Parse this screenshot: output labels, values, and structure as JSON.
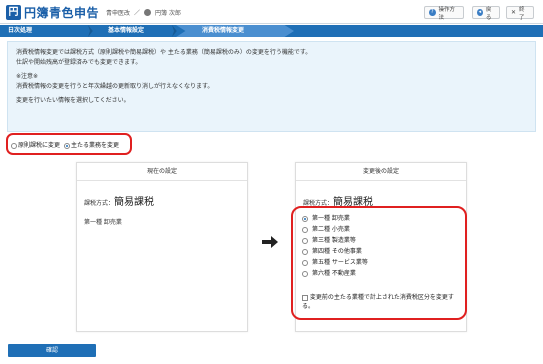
{
  "app": {
    "logo_glyph": "円",
    "title": "円簿青色申告"
  },
  "user": {
    "office": "青申医改",
    "separator": "／",
    "name": "円簿 次郎"
  },
  "header_buttons": [
    {
      "label": "操作方法",
      "icon": "help-icon"
    },
    {
      "label": "戻る",
      "icon": "back-icon"
    },
    {
      "label": "終了",
      "icon": "close-icon"
    }
  ],
  "breadcrumb": {
    "items": [
      "日次処理",
      "基本情報設定",
      "消費税情報変更"
    ]
  },
  "info": {
    "line1": "消費税情報変更では課税方式（原則課税や簡易課税）や 主たる業務（簡易課税のみ）の変更を行う機能です。",
    "line2": "仕訳や開始残高が登録済みでも変更できます。",
    "note_title": "※注意※",
    "note_body": "消費税情報の変更を行うと年次繰越の更新取り消しが行えなくなります。",
    "instruction": "変更を行いたい情報を選択してください。"
  },
  "mode_options": [
    {
      "label": "原則課税に変更",
      "selected": false
    },
    {
      "label": "主たる業務を変更",
      "selected": true
    }
  ],
  "current": {
    "title": "現在の設定",
    "tax_label": "課税方式：",
    "tax_value": "簡易課税",
    "business": "第一種 卸売業"
  },
  "after": {
    "title": "変更後の設定",
    "tax_label": "課税方式：",
    "tax_value": "簡易課税",
    "options": [
      {
        "label": "第一種 卸売業",
        "selected": true
      },
      {
        "label": "第二種 小売業",
        "selected": false
      },
      {
        "label": "第三種 製造業等",
        "selected": false
      },
      {
        "label": "第四種 その他事業",
        "selected": false
      },
      {
        "label": "第五種 サービス業等",
        "selected": false
      },
      {
        "label": "第六種 不動産業",
        "selected": false
      }
    ],
    "checkbox_label": "変更前の主たる業種で計上された消費税区分を変更する。"
  },
  "confirm_label": "確認",
  "colors": {
    "primary": "#1f6fb6",
    "highlight": "#e02020",
    "info_bg": "#eaf4fb"
  }
}
